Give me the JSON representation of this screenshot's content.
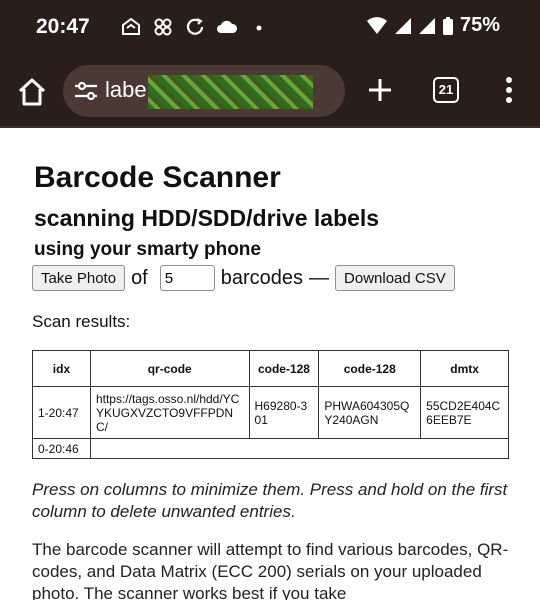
{
  "status_bar": {
    "time": "20:47",
    "notification_icons": [
      "inbox-icon",
      "pinwheel-icon",
      "sync-icon",
      "cloud-icon",
      "dot-icon"
    ],
    "battery": "75%"
  },
  "browser": {
    "url_text": "labe",
    "tab_count": "21"
  },
  "page": {
    "title": "Barcode Scanner",
    "subtitle": "scanning HDD/SDD/drive labels",
    "subtitle2": "using your smarty phone",
    "take_photo_label": "Take Photo",
    "of_label": "of",
    "barcode_count": "5",
    "barcodes_label": "barcodes",
    "dash": "—",
    "download_label": "Download CSV",
    "scan_results_label": "Scan results:",
    "table": {
      "headers": [
        "idx",
        "qr-code",
        "code-128",
        "code-128",
        "dmtx"
      ],
      "rows": [
        [
          "1-20:47",
          "https://tags.osso.nl/hdd/YCYKUGXVZCTO9VFFPDNC/",
          "H69280-301",
          "PHWA604305QY240AGN",
          "55CD2E404C6EEB7E"
        ],
        [
          "0-20:46",
          "",
          "",
          "",
          ""
        ]
      ]
    },
    "hint": "Press on columns to minimize them. Press and hold on the first column to delete unwanted entries.",
    "description": "The barcode scanner will attempt to find various barcodes, QR-codes, and Data Matrix (ECC 200) serials on your uploaded photo. The scanner works best if you take"
  }
}
